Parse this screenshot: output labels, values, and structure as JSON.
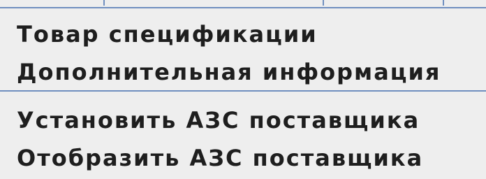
{
  "context_menu": {
    "items": [
      {
        "label": "Товар спецификации"
      },
      {
        "label": "Дополнительная информация"
      },
      {
        "label": "Установить АЗС поставщика"
      },
      {
        "label": "Отобразить АЗС поставщика"
      }
    ]
  }
}
